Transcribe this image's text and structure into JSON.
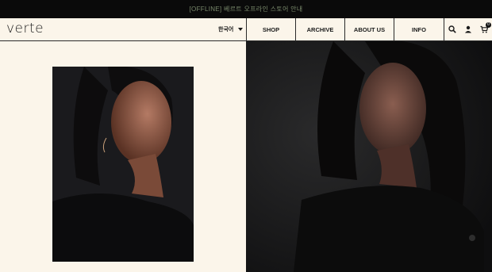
{
  "announcement": "[OFFLINE] 베르트 오프라인 스토어 안내",
  "logo": "verte",
  "language": {
    "selected": "한국어"
  },
  "nav": [
    {
      "label": "SHOP"
    },
    {
      "label": "ARCHIVE"
    },
    {
      "label": "ABOUT US"
    },
    {
      "label": "INFO"
    }
  ],
  "icons": [
    "search-icon",
    "user-icon",
    "cart-icon"
  ],
  "cart": {
    "count": "0"
  },
  "colors": {
    "background": "#fbf5ea",
    "topbar": "#0a0a0a",
    "announcement_text": "#7a8a6c",
    "ink": "#1a1a1a"
  }
}
